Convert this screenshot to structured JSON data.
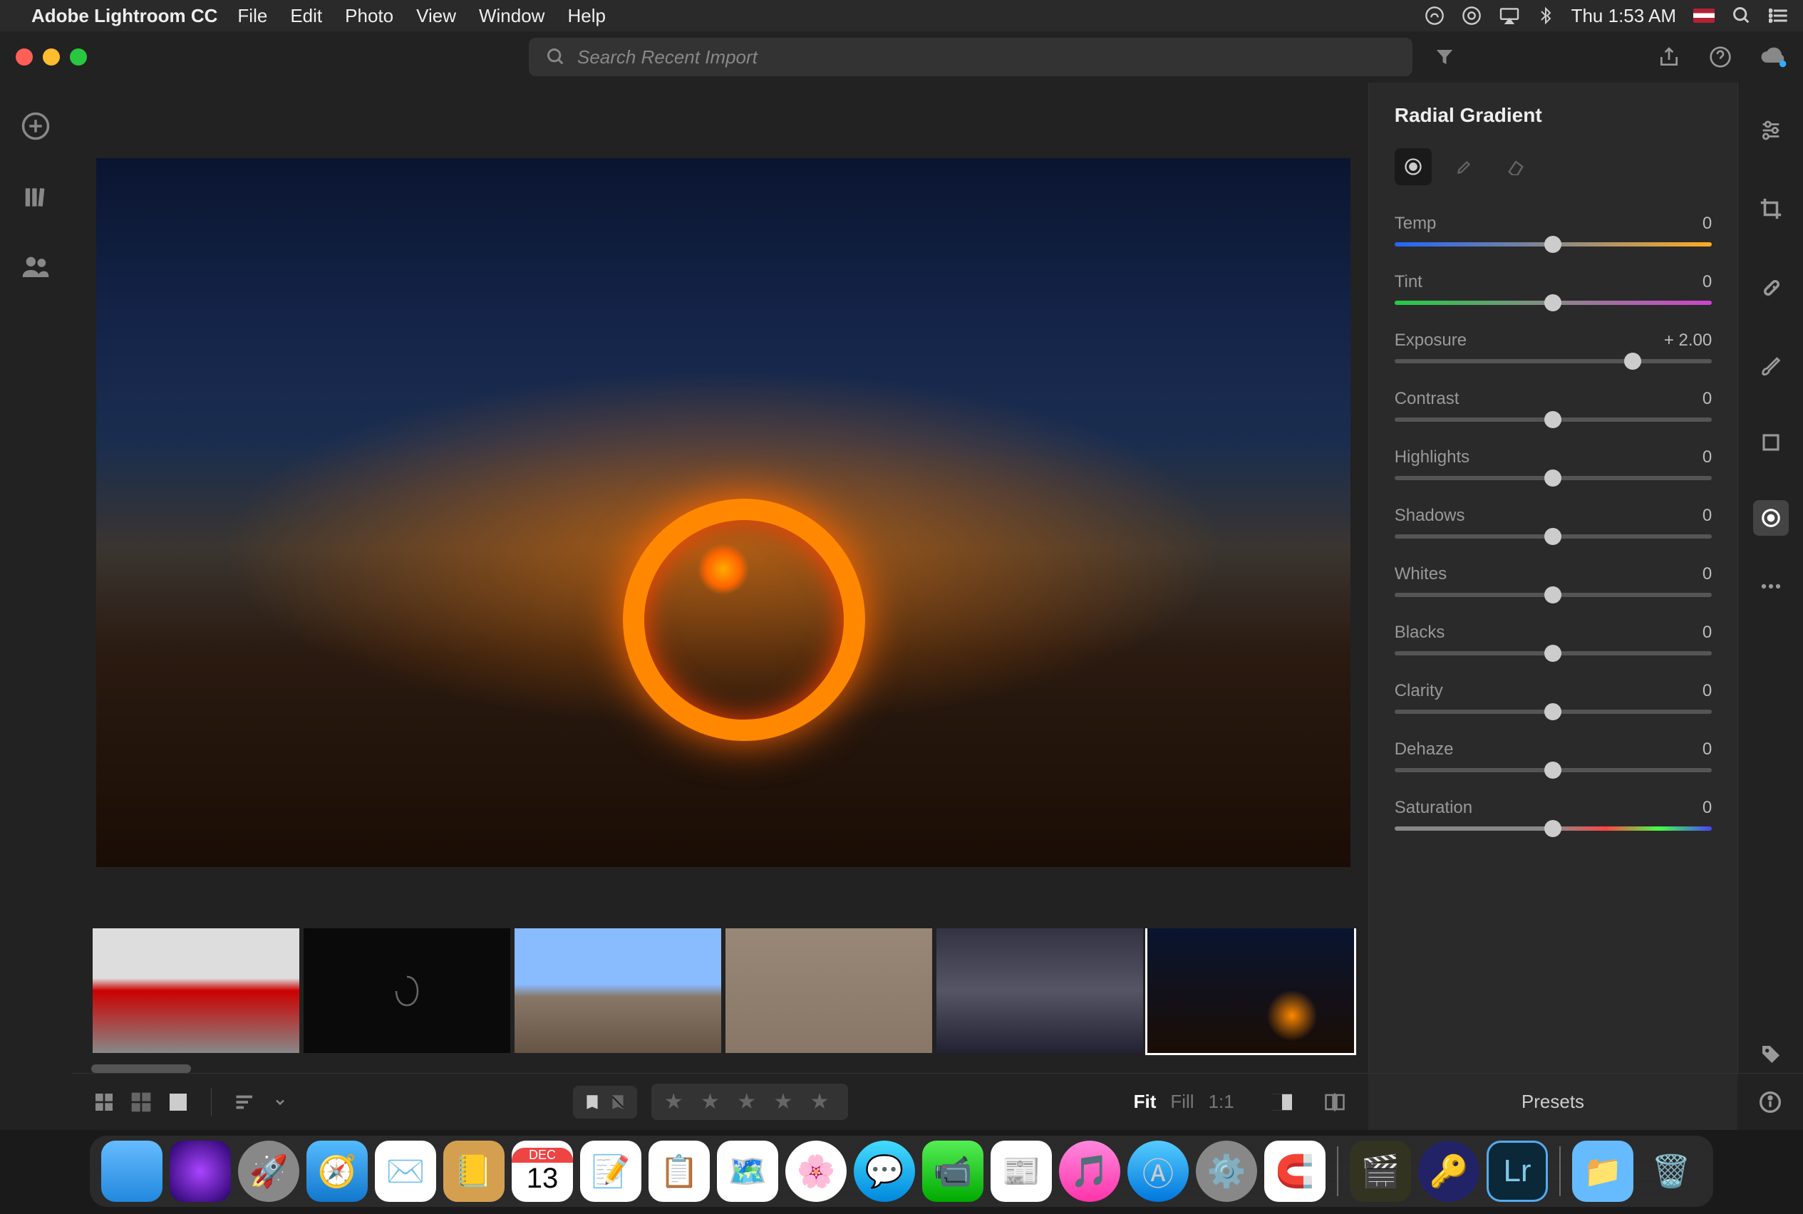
{
  "menubar": {
    "app_name": "Adobe Lightroom CC",
    "items": [
      "File",
      "Edit",
      "Photo",
      "View",
      "Window",
      "Help"
    ],
    "clock": "Thu 1:53 AM"
  },
  "titlebar": {
    "search_placeholder": "Search Recent Import"
  },
  "panel": {
    "title": "Radial Gradient",
    "sliders": [
      {
        "label": "Temp",
        "value": "0",
        "pos": 50,
        "track": "temp"
      },
      {
        "label": "Tint",
        "value": "0",
        "pos": 50,
        "track": "tint"
      },
      {
        "label": "Exposure",
        "value": "+ 2.00",
        "pos": 75,
        "track": "plain"
      },
      {
        "label": "Contrast",
        "value": "0",
        "pos": 50,
        "track": "plain"
      },
      {
        "label": "Highlights",
        "value": "0",
        "pos": 50,
        "track": "plain"
      },
      {
        "label": "Shadows",
        "value": "0",
        "pos": 50,
        "track": "plain"
      },
      {
        "label": "Whites",
        "value": "0",
        "pos": 50,
        "track": "plain"
      },
      {
        "label": "Blacks",
        "value": "0",
        "pos": 50,
        "track": "plain"
      },
      {
        "label": "Clarity",
        "value": "0",
        "pos": 50,
        "track": "plain"
      },
      {
        "label": "Dehaze",
        "value": "0",
        "pos": 50,
        "track": "plain"
      },
      {
        "label": "Saturation",
        "value": "0",
        "pos": 50,
        "track": "sat"
      }
    ]
  },
  "bottom": {
    "zoom": {
      "fit": "Fit",
      "fill": "Fill",
      "one": "1:1"
    },
    "presets": "Presets"
  },
  "dock": {
    "date_month": "DEC",
    "date_day": "13"
  }
}
